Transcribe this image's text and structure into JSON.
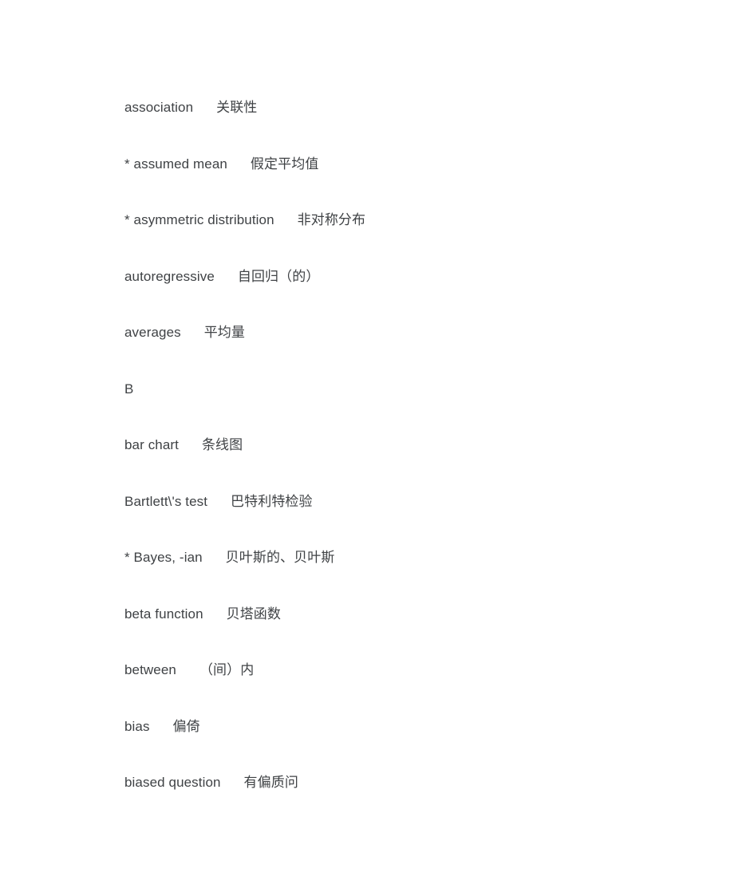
{
  "document": {
    "background_color": "#ffffff",
    "text_color": "#3f4245",
    "separator": "      "
  },
  "entries": [
    {
      "kind": "entry",
      "term": "association",
      "gloss": "关联性"
    },
    {
      "kind": "entry",
      "term": "* assumed mean",
      "gloss": "假定平均值"
    },
    {
      "kind": "entry",
      "term": "* asymmetric distribution",
      "gloss": "非对称分布"
    },
    {
      "kind": "entry",
      "term": "autoregressive",
      "gloss": "自回归（的）"
    },
    {
      "kind": "entry",
      "term": "averages",
      "gloss": "平均量"
    },
    {
      "kind": "section",
      "term": "B",
      "gloss": ""
    },
    {
      "kind": "entry",
      "term": "bar chart",
      "gloss": "条线图"
    },
    {
      "kind": "entry",
      "term": "Bartlett\\'s test",
      "gloss": "巴特利特检验"
    },
    {
      "kind": "entry",
      "term": "* Bayes, -ian",
      "gloss": "贝叶斯的、贝叶斯"
    },
    {
      "kind": "entry",
      "term": "beta function",
      "gloss": "贝塔函数"
    },
    {
      "kind": "entry",
      "term": "between",
      "gloss": "（间）内"
    },
    {
      "kind": "entry",
      "term": "bias",
      "gloss": "偏倚"
    },
    {
      "kind": "entry",
      "term": "biased question",
      "gloss": "有偏质问"
    }
  ]
}
